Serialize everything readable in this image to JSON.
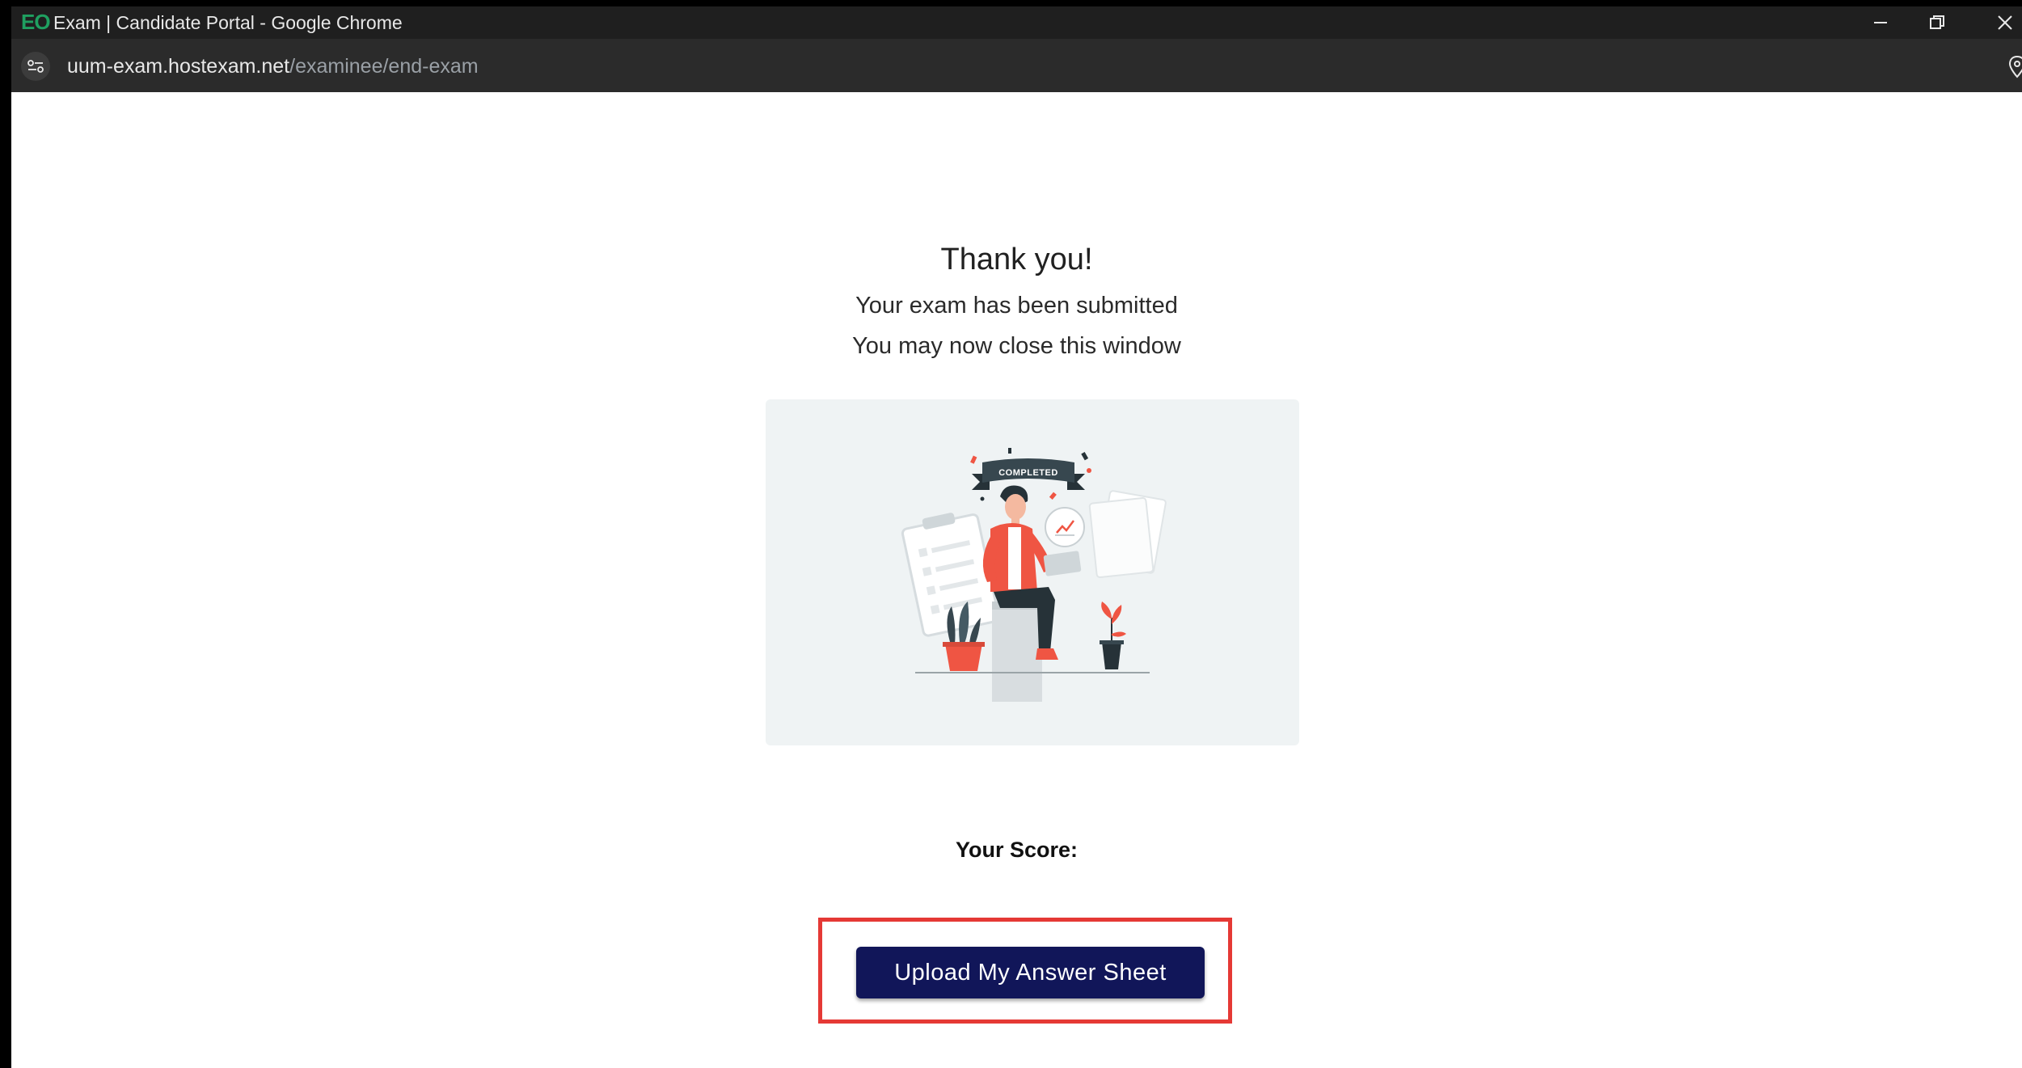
{
  "browser": {
    "window_title": "Exam | Candidate Portal - Google Chrome",
    "favicon_text": "EO",
    "url_host": "uum-exam.hostexam.net",
    "url_path": "/examinee/end-exam",
    "icons": [
      "minimize-icon",
      "restore-icon",
      "close-icon",
      "site-info-icon",
      "location-icon"
    ]
  },
  "page": {
    "heading": "Thank you!",
    "line1": "Your exam has been submitted",
    "line2": "You may now close this window",
    "illustration_banner": "COMPLETED",
    "score_label": "Your Score:",
    "upload_button": "Upload My Answer Sheet"
  },
  "colors": {
    "button_bg": "#111659",
    "highlight": "#e53935",
    "accent": "#ef5543",
    "illustration_bg": "#eff3f4"
  }
}
